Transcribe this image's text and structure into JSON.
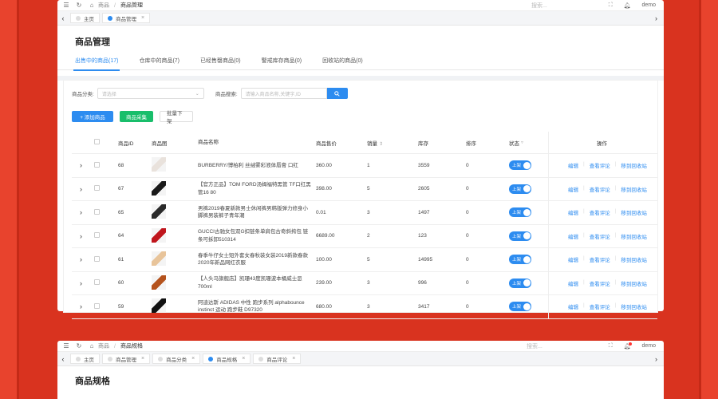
{
  "colors": {
    "accent": "#2d8cf0",
    "green": "#19be6b",
    "background": "#d9331f"
  },
  "window1": {
    "breadcrumb": {
      "home": "商品",
      "current": "商品管理"
    },
    "search_placeholder": "搜索...",
    "user": "demo",
    "tabs": [
      {
        "label": "主页",
        "active": false,
        "closable": false
      },
      {
        "label": "商品管理",
        "active": true,
        "closable": true
      }
    ],
    "page_title": "商品管理",
    "subtabs": [
      {
        "label": "出售中的商品(17)",
        "active": true
      },
      {
        "label": "仓库中的商品(7)",
        "active": false
      },
      {
        "label": "已经售罄商品(0)",
        "active": false
      },
      {
        "label": "警戒库存商品(0)",
        "active": false
      },
      {
        "label": "回收站的商品(0)",
        "active": false
      }
    ],
    "filters": {
      "category_label": "商品分类:",
      "category_placeholder": "请选择",
      "search_label": "商品搜索:",
      "search_placeholder": "请输入商品名称,关键字,ID"
    },
    "actions": {
      "add": "+ 添加商品",
      "collect": "商品采集",
      "batch_off": "批量下架"
    },
    "table": {
      "headers": {
        "id": "商品ID",
        "img": "商品图",
        "name": "商品名称",
        "price": "商品售价",
        "sales": "销量",
        "stock": "库存",
        "sort": "排序",
        "status": "状态",
        "ops": "操作"
      },
      "rows": [
        {
          "id": "68",
          "name": "BURBERRY/博柏利 丝绒雾彩液体唇膏 口红",
          "price": "360.00",
          "sales": "1",
          "stock": "3559",
          "sort": "0",
          "status": "上架"
        },
        {
          "id": "67",
          "name": "【官方正品】TOM FORD汤姆福特黑管 TF口红黑管16 80",
          "price": "398.00",
          "sales": "5",
          "stock": "2605",
          "sort": "0",
          "status": "上架"
        },
        {
          "id": "65",
          "name": "男裤2019春夏新款男士休闲裤男韩版弹力修身小脚裤男装裤子青年潮",
          "price": "0.01",
          "sales": "3",
          "stock": "1497",
          "sort": "0",
          "status": "上架"
        },
        {
          "id": "64",
          "name": "GUCCI古驰女包双G扣链条单肩包古奇斜挎包 链条可拆卸510314",
          "price": "6689.00",
          "sales": "2",
          "stock": "123",
          "sort": "0",
          "status": "上架"
        },
        {
          "id": "61",
          "name": "春季牛仔女士短外套女春秋装女装2019新款春款2020年新品网红衣服",
          "price": "100.00",
          "sales": "5",
          "stock": "14995",
          "sort": "0",
          "status": "上架"
        },
        {
          "id": "60",
          "name": "【人头马旗舰店】凯珊43度凯珊波本桶威士忌700ml",
          "price": "239.00",
          "sales": "3",
          "stock": "996",
          "sort": "0",
          "status": "上架"
        },
        {
          "id": "59",
          "name": "阿迪达斯 ADIDAS 中性 跑步系列 alphabounce instinct 运动 跑步鞋 D97320",
          "price": "680.00",
          "sales": "3",
          "stock": "3417",
          "sort": "0",
          "status": "上架"
        }
      ],
      "ops": {
        "edit": "编辑",
        "comments": "查看评论",
        "recycle": "移到回收站"
      }
    }
  },
  "window2": {
    "breadcrumb": {
      "home": "商品",
      "current": "商品规格"
    },
    "search_placeholder": "搜索...",
    "user": "demo",
    "tabs": [
      {
        "label": "主页",
        "active": false,
        "closable": false
      },
      {
        "label": "商品管理",
        "active": false,
        "closable": true
      },
      {
        "label": "商品分类",
        "active": false,
        "closable": true
      },
      {
        "label": "商品规格",
        "active": true,
        "closable": true
      },
      {
        "label": "商品评论",
        "active": false,
        "closable": true
      }
    ],
    "page_title": "商品规格"
  }
}
